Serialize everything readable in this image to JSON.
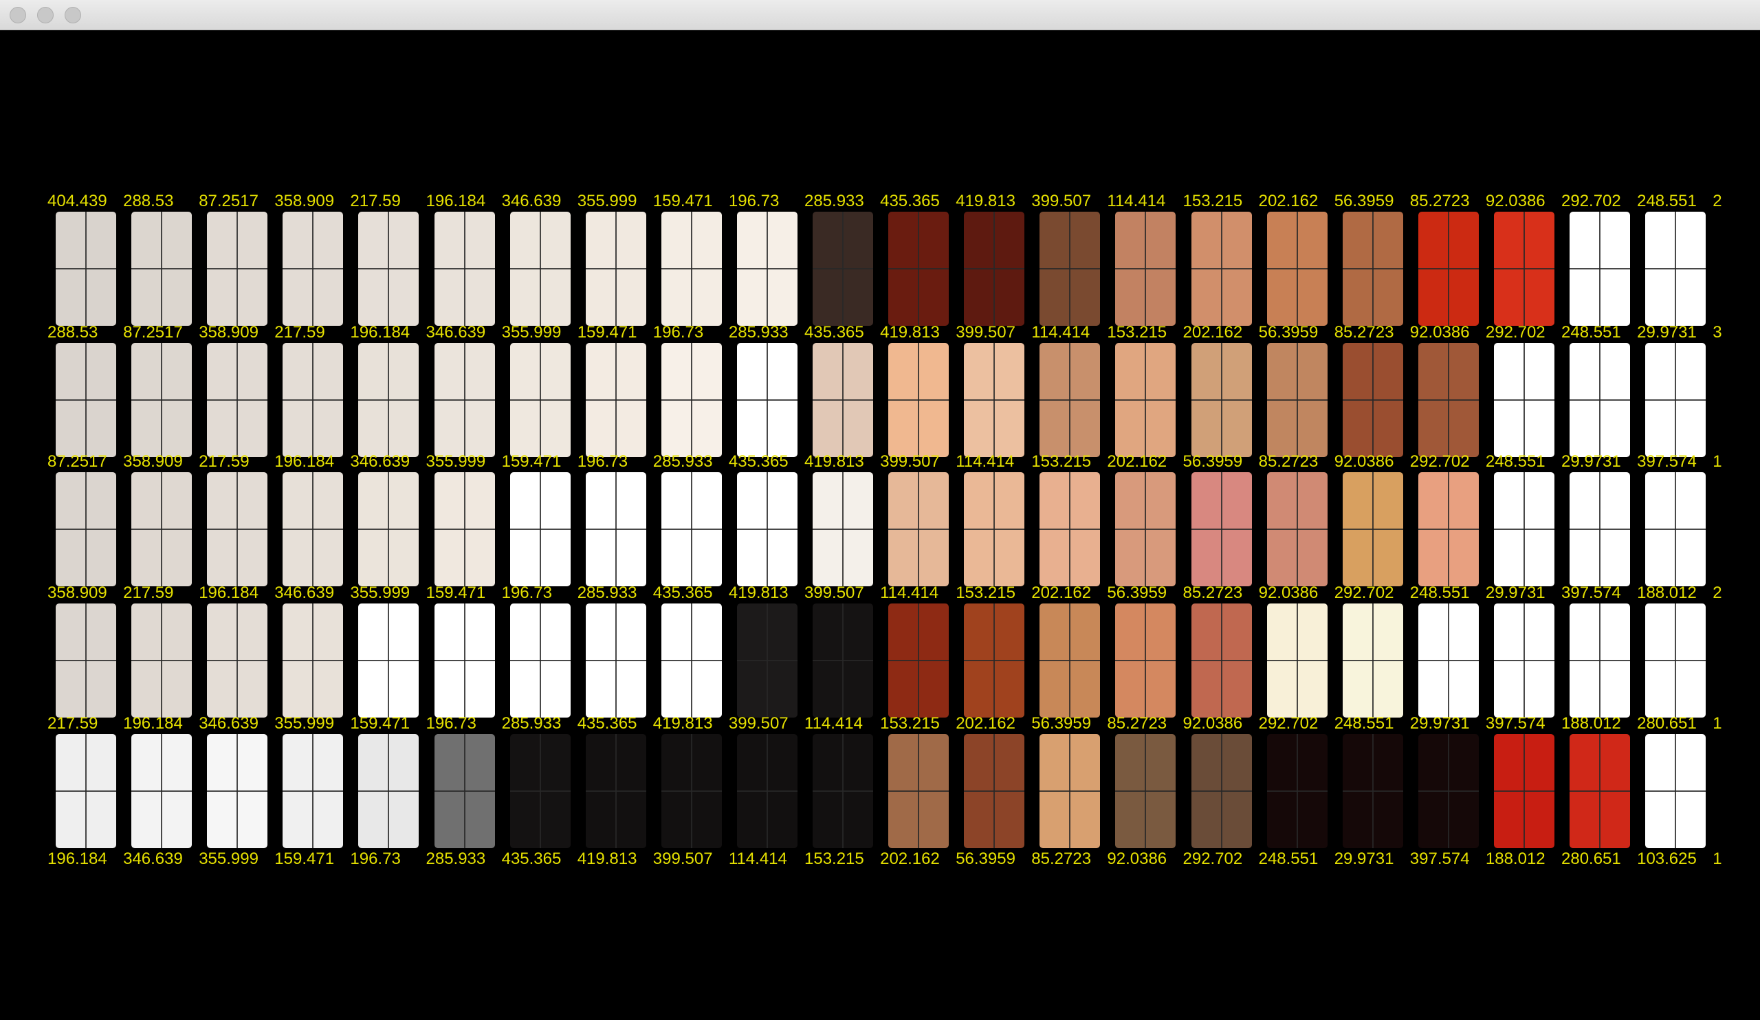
{
  "window": {
    "title": "",
    "buttons": [
      "close",
      "minimize",
      "zoom"
    ]
  },
  "label_color": "#e5e000",
  "grid": {
    "rows": [
      {
        "labels_above": [
          "404.439",
          "288.53",
          "87.2517",
          "358.909",
          "217.59",
          "196.184",
          "346.639",
          "355.999",
          "159.471",
          "196.73",
          "285.933",
          "435.365",
          "419.813",
          "399.507",
          "114.414",
          "153.215",
          "202.162",
          "56.3959",
          "85.2723",
          "92.0386",
          "292.702",
          "248.551",
          "2"
        ],
        "cell_colors": [
          "#d9d3cd",
          "#dcd6cf",
          "#e1dad3",
          "#e3dcd5",
          "#e6dfd8",
          "#e9e2da",
          "#ede6dd",
          "#f1e9e0",
          "#f4ede4",
          "#f6efe7",
          "#3a2a24",
          "#6a1c10",
          "#5e1a10",
          "#7a4a30",
          "#c28262",
          "#d18f6b",
          "#c88055",
          "#b06a44",
          "#cc2a12",
          "#d8301a",
          "#ffffff",
          "#ffffff"
        ]
      },
      {
        "labels_above": [
          "288.53",
          "87.2517",
          "358.909",
          "217.59",
          "196.184",
          "346.639",
          "355.999",
          "159.471",
          "196.73",
          "285.933",
          "435.365",
          "419.813",
          "399.507",
          "114.414",
          "153.215",
          "202.162",
          "56.3959",
          "85.2723",
          "92.0386",
          "292.702",
          "248.551",
          "29.9731",
          "3"
        ],
        "cell_colors": [
          "#dad4ce",
          "#ddd7d0",
          "#e2dbd4",
          "#e4ddd6",
          "#e8e1d9",
          "#ebe4dc",
          "#efe8df",
          "#f3ebe2",
          "#f7f0e8",
          "#ffffff",
          "#e1c8b6",
          "#f0b890",
          "#ecc0a0",
          "#c8906c",
          "#e0a680",
          "#d0a078",
          "#c08660",
          "#9a4e30",
          "#a05838",
          "#ffffff",
          "#ffffff",
          "#ffffff"
        ]
      },
      {
        "labels_above": [
          "87.2517",
          "358.909",
          "217.59",
          "196.184",
          "346.639",
          "355.999",
          "159.471",
          "196.73",
          "285.933",
          "435.365",
          "419.813",
          "399.507",
          "114.414",
          "153.215",
          "202.162",
          "56.3959",
          "85.2723",
          "92.0386",
          "292.702",
          "248.551",
          "29.9731",
          "397.574",
          "1"
        ],
        "cell_colors": [
          "#dbd5cf",
          "#dfd8d1",
          "#e3dcd5",
          "#e7e0d8",
          "#ebe4db",
          "#f0e8df",
          "#ffffff",
          "#ffffff",
          "#ffffff",
          "#ffffff",
          "#f4f0ea",
          "#e6b898",
          "#eab896",
          "#e8b090",
          "#d89a7c",
          "#d88880",
          "#d08a74",
          "#d8a060",
          "#e8a080",
          "#ffffff",
          "#ffffff",
          "#ffffff"
        ]
      },
      {
        "labels_above": [
          "358.909",
          "217.59",
          "196.184",
          "346.639",
          "355.999",
          "159.471",
          "196.73",
          "285.933",
          "435.365",
          "419.813",
          "399.507",
          "114.414",
          "153.215",
          "202.162",
          "56.3959",
          "85.2723",
          "92.0386",
          "292.702",
          "248.551",
          "29.9731",
          "397.574",
          "188.012",
          "2"
        ],
        "cell_colors": [
          "#dcd6d0",
          "#e0d9d2",
          "#e4ddd6",
          "#e8e1d9",
          "#ffffff",
          "#ffffff",
          "#ffffff",
          "#ffffff",
          "#ffffff",
          "#1c1a1a",
          "#151313",
          "#8e2a14",
          "#a0421e",
          "#c88858",
          "#d48860",
          "#c06850",
          "#f8f0d8",
          "#f8f4dc",
          "#ffffff",
          "#ffffff",
          "#ffffff",
          "#ffffff"
        ]
      },
      {
        "labels_above": [
          "217.59",
          "196.184",
          "346.639",
          "355.999",
          "159.471",
          "196.73",
          "285.933",
          "435.365",
          "419.813",
          "399.507",
          "114.414",
          "153.215",
          "202.162",
          "56.3959",
          "85.2723",
          "92.0386",
          "292.702",
          "248.551",
          "29.9731",
          "397.574",
          "188.012",
          "280.651",
          "1"
        ],
        "cell_colors": [
          "#efefef",
          "#f3f3f3",
          "#f6f6f6",
          "#f0f0f0",
          "#e8e8e8",
          "#707070",
          "#141212",
          "#121010",
          "#121010",
          "#121010",
          "#121010",
          "#a06a48",
          "#8c4428",
          "#d8a070",
          "#7a5a40",
          "#6a4c38",
          "#150808",
          "#150808",
          "#150808",
          "#c81e12",
          "#d02818",
          "#ffffff"
        ]
      }
    ],
    "labels_below": [
      "196.184",
      "346.639",
      "355.999",
      "159.471",
      "196.73",
      "285.933",
      "435.365",
      "419.813",
      "399.507",
      "114.414",
      "153.215",
      "202.162",
      "56.3959",
      "85.2723",
      "92.0386",
      "292.702",
      "248.551",
      "29.9731",
      "397.574",
      "188.012",
      "280.651",
      "103.625",
      "1"
    ]
  }
}
